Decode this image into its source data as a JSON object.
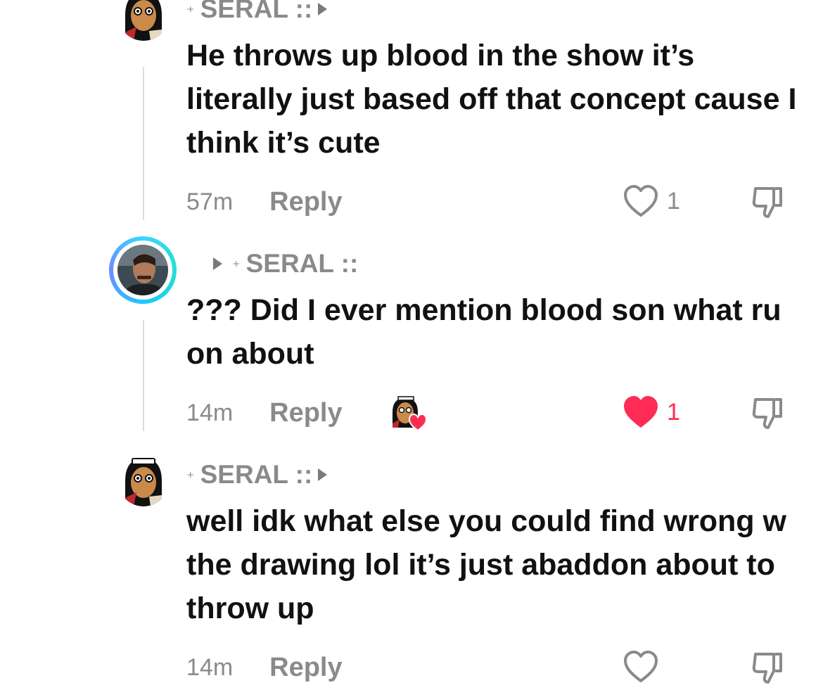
{
  "comments": [
    {
      "username": "SERAL ::",
      "sparkle": "⁺",
      "text": "He throws up blood in the show it’s literally just based off that concept cause I think it’s cute",
      "time": "57m",
      "reply_label": "Reply",
      "likes": "1",
      "liked": false,
      "avatar": "cartoon-avatar"
    },
    {
      "username": "SERAL ::",
      "sparkle": "⁺",
      "text": "??? Did I ever mention blood son what ru on about",
      "time": "14m",
      "reply_label": "Reply",
      "likes": "1",
      "liked": true,
      "avatar": "photo-avatar"
    },
    {
      "username": "SERAL ::",
      "sparkle": "⁺",
      "text": "well idk what else you could find wrong w the drawing lol it’s just abaddon about to throw up",
      "time": "14m",
      "reply_label": "Reply",
      "likes": "",
      "liked": false,
      "avatar": "cartoon-avatar"
    }
  ],
  "colors": {
    "muted": "#8a8a8a",
    "like_red": "#fe2c55",
    "text": "#111111",
    "ring": "#3ad6ff"
  }
}
